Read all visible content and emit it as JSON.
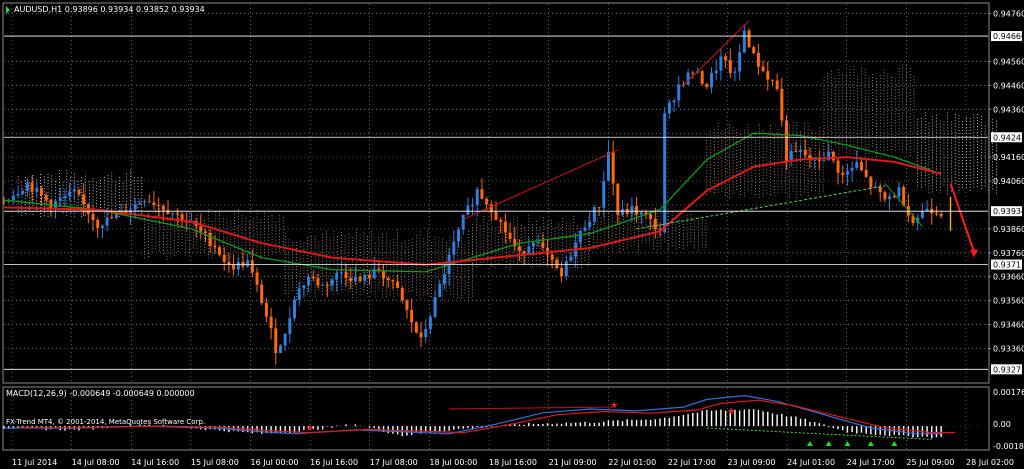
{
  "main_header": "AUDUSD,H1  0.93896 0.93934 0.93852 0.93934",
  "macd_header": "MACD(12,26,9) -0.000649 -0.000649 0.000000",
  "watermark": "FX-Trend MT4, © 2001-2014, MetaQuotes Software Corp.",
  "colors": {
    "background": "#000000",
    "grid": "#8a8a8a",
    "bull_candle": "#2f7fdc",
    "bear_candle": "#ff6a10",
    "ma_fast": "#0f9a1a",
    "ma_slow": "#e01818",
    "ichimoku_cloud": "#c9a98b",
    "cloud_top_white": "#ffffff",
    "trend_lines": "#d01010",
    "support_line": "#4fd94f",
    "forecast_arrow": "#ff1a1a",
    "current_bar": "#ffb020",
    "macd_hist": "#ffffff",
    "macd_signal_blue": "#2f6fe0",
    "macd_signal_red": "#e01818",
    "arrow_green": "#22dd22",
    "star_red": "#ff2020"
  },
  "chart_data": [
    {
      "type": "candlestick",
      "symbol": "AUDUSD",
      "timeframe": "H1",
      "ohlc_last": {
        "open": 0.93896,
        "high": 0.93934,
        "low": 0.93852,
        "close": 0.93934
      },
      "ylim": [
        0.9322,
        0.948
      ],
      "y_tick_labels": [
        "0.94760",
        "0.94560",
        "0.94460",
        "0.94360",
        "0.94260",
        "0.94160",
        "0.94060",
        "0.93960",
        "0.93860",
        "0.93760",
        "0.93660",
        "0.93560",
        "0.93460",
        "0.93360"
      ],
      "x_tick_labels": [
        "11 Jul 2014",
        "14 Jul 08:00",
        "14 Jul 16:00",
        "15 Jul 08:00",
        "16 Jul 00:00",
        "16 Jul 16:00",
        "17 Jul 08:00",
        "18 Jul 00:00",
        "18 Jul 16:00",
        "21 Jul 09:00",
        "22 Jul 01:00",
        "22 Jul 17:00",
        "23 Jul 09:00",
        "24 Jul 01:00",
        "24 Jul 17:00",
        "25 Jul 09:00",
        "28 Jul 02:00"
      ],
      "horizontal_levels": [
        {
          "label": "0.94666",
          "value": 0.94666
        },
        {
          "label": "0.94243",
          "value": 0.94243
        },
        {
          "label": "0.93934",
          "value": 0.93934
        },
        {
          "label": "0.93711",
          "value": 0.93711
        },
        {
          "label": "0.93273",
          "value": 0.93273
        }
      ],
      "close_path": [
        [
          0,
          0.9398
        ],
        [
          5,
          0.9405
        ],
        [
          10,
          0.9396
        ],
        [
          15,
          0.9401
        ],
        [
          20,
          0.9388
        ],
        [
          25,
          0.9392
        ],
        [
          30,
          0.9399
        ],
        [
          35,
          0.9394
        ],
        [
          40,
          0.9388
        ],
        [
          45,
          0.9379
        ],
        [
          48,
          0.937
        ],
        [
          52,
          0.9372
        ],
        [
          55,
          0.9356
        ],
        [
          58,
          0.9336
        ],
        [
          60,
          0.9341
        ],
        [
          62,
          0.9358
        ],
        [
          65,
          0.9366
        ],
        [
          68,
          0.9362
        ],
        [
          72,
          0.9368
        ],
        [
          76,
          0.9364
        ],
        [
          80,
          0.9369
        ],
        [
          84,
          0.936
        ],
        [
          87,
          0.9347
        ],
        [
          89,
          0.9339
        ],
        [
          92,
          0.9356
        ],
        [
          95,
          0.9374
        ],
        [
          98,
          0.939
        ],
        [
          101,
          0.9402
        ],
        [
          104,
          0.9395
        ],
        [
          107,
          0.9385
        ],
        [
          110,
          0.9375
        ],
        [
          113,
          0.9382
        ],
        [
          116,
          0.9374
        ],
        [
          119,
          0.9366
        ],
        [
          121,
          0.9376
        ],
        [
          124,
          0.9388
        ],
        [
          127,
          0.9396
        ],
        [
          129,
          0.9418
        ],
        [
          131,
          0.9392
        ],
        [
          134,
          0.9394
        ],
        [
          137,
          0.9391
        ],
        [
          140,
          0.9385
        ],
        [
          141,
          0.9433
        ],
        [
          144,
          0.9446
        ],
        [
          147,
          0.9452
        ],
        [
          150,
          0.9446
        ],
        [
          153,
          0.9457
        ],
        [
          156,
          0.945
        ],
        [
          158,
          0.9469
        ],
        [
          160,
          0.9458
        ],
        [
          162,
          0.9452
        ],
        [
          165,
          0.9445
        ],
        [
          167,
          0.9416
        ],
        [
          170,
          0.9418
        ],
        [
          173,
          0.9414
        ],
        [
          176,
          0.9417
        ],
        [
          179,
          0.9408
        ],
        [
          182,
          0.9413
        ],
        [
          185,
          0.9404
        ],
        [
          188,
          0.9398
        ],
        [
          191,
          0.9402
        ],
        [
          194,
          0.9389
        ],
        [
          197,
          0.9395
        ],
        [
          200,
          0.9393
        ]
      ],
      "ma_fast_path": [
        [
          0,
          0.9398
        ],
        [
          20,
          0.9394
        ],
        [
          40,
          0.9386
        ],
        [
          55,
          0.9374
        ],
        [
          70,
          0.9369
        ],
        [
          90,
          0.9368
        ],
        [
          110,
          0.938
        ],
        [
          125,
          0.9384
        ],
        [
          140,
          0.9394
        ],
        [
          150,
          0.9415
        ],
        [
          160,
          0.9426
        ],
        [
          170,
          0.9425
        ],
        [
          180,
          0.9421
        ],
        [
          190,
          0.9416
        ],
        [
          200,
          0.9409
        ]
      ],
      "ma_slow_path": [
        [
          0,
          0.9395
        ],
        [
          20,
          0.9394
        ],
        [
          40,
          0.9389
        ],
        [
          55,
          0.938
        ],
        [
          70,
          0.9374
        ],
        [
          90,
          0.9371
        ],
        [
          110,
          0.9375
        ],
        [
          125,
          0.9378
        ],
        [
          140,
          0.9385
        ],
        [
          150,
          0.9402
        ],
        [
          160,
          0.9412
        ],
        [
          170,
          0.9415
        ],
        [
          180,
          0.9416
        ],
        [
          190,
          0.9414
        ],
        [
          200,
          0.9409
        ]
      ],
      "trend_lines": [
        {
          "from": [
            98,
            0.939
          ],
          "to": [
            131,
            0.9419
          ]
        },
        {
          "from": [
            145,
            0.9446
          ],
          "to": [
            159,
            0.9473
          ]
        },
        {
          "from": [
            135,
            0.9386
          ],
          "to": [
            188,
            0.9404
          ]
        }
      ],
      "forecast_arrow": {
        "from": [
          202,
          0.9405
        ],
        "to": [
          207,
          0.9374
        ]
      }
    },
    {
      "type": "line",
      "name": "MACD(12,26,9)",
      "values_header": [
        -0.000649,
        -0.000649,
        0.0
      ],
      "ylim": [
        -0.0012,
        0.002
      ],
      "y_tick_labels": [
        "0.00176",
        "0.00",
        "-0.00186"
      ],
      "histogram_path": [
        [
          0,
          -0.0001
        ],
        [
          15,
          -0.0002
        ],
        [
          30,
          0.0001
        ],
        [
          45,
          -0.0002
        ],
        [
          55,
          -0.0004
        ],
        [
          62,
          -0.0003
        ],
        [
          75,
          0.0001
        ],
        [
          85,
          -0.0005
        ],
        [
          95,
          -0.0002
        ],
        [
          110,
          0.0001
        ],
        [
          125,
          0.0002
        ],
        [
          140,
          0.0004
        ],
        [
          150,
          0.0008
        ],
        [
          160,
          0.0009
        ],
        [
          170,
          0.0004
        ],
        [
          180,
          -0.0003
        ],
        [
          190,
          -0.0005
        ],
        [
          200,
          -0.0006
        ]
      ],
      "signal_path": [
        [
          0,
          -0.0001
        ],
        [
          15,
          -0.0001
        ],
        [
          30,
          0.0
        ],
        [
          45,
          -0.0001
        ],
        [
          55,
          -0.0003
        ],
        [
          62,
          -0.0004
        ],
        [
          75,
          -0.0002
        ],
        [
          85,
          -0.0003
        ],
        [
          95,
          -0.0004
        ],
        [
          105,
          0.0001
        ],
        [
          115,
          0.0007
        ],
        [
          125,
          0.0009
        ],
        [
          135,
          0.0008
        ],
        [
          145,
          0.001
        ],
        [
          150,
          0.0014
        ],
        [
          158,
          0.0016
        ],
        [
          165,
          0.0013
        ],
        [
          175,
          0.0006
        ],
        [
          185,
          -0.0001
        ],
        [
          195,
          -0.0004
        ],
        [
          200,
          -0.0004
        ]
      ]
    }
  ]
}
